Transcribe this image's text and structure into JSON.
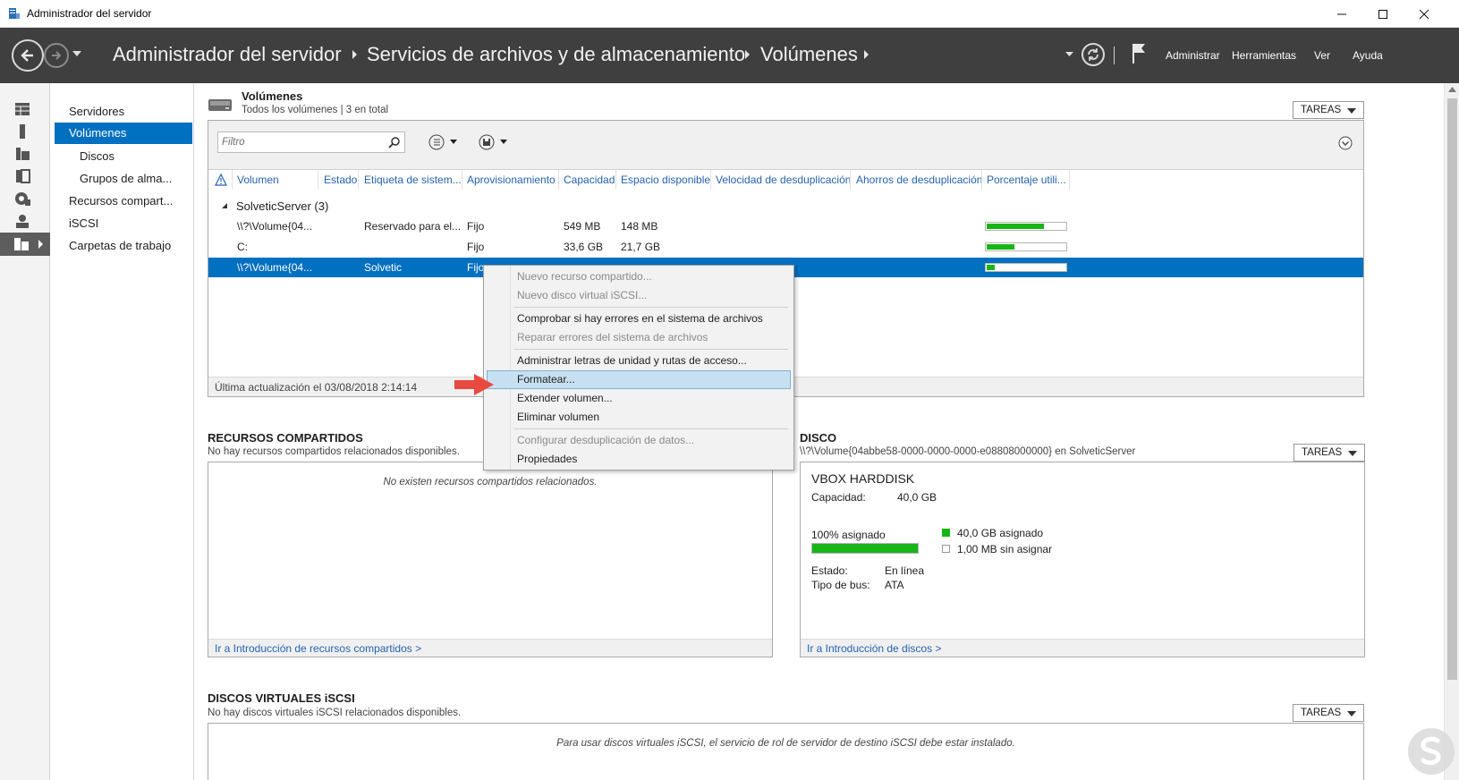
{
  "window": {
    "title": "Administrador del servidor"
  },
  "header": {
    "breadcrumb": [
      "Administrador del servidor",
      "Servicios de archivos y de almacenamiento",
      "Volúmenes"
    ],
    "menu": [
      "Administrar",
      "Herramientas",
      "Ver",
      "Ayuda"
    ]
  },
  "rail": {
    "icons": [
      "dashboard-icon",
      "local-server-icon",
      "all-servers-icon",
      "file-services-icon",
      "iis-icon",
      "roles-icon",
      "storage-icon"
    ]
  },
  "nav": {
    "items": [
      "Servidores",
      "Volúmenes",
      "Discos",
      "Grupos de alma...",
      "Recursos compart...",
      "iSCSI",
      "Carpetas de trabajo"
    ]
  },
  "volumes": {
    "title": "Volúmenes",
    "subtitle": "Todos los volúmenes | 3 en total",
    "tasks": "TAREAS",
    "filter_placeholder": "Filtro",
    "columns": [
      "Volumen",
      "Estado",
      "Etiqueta de sistem...",
      "Aprovisionamiento",
      "Capacidad",
      "Espacio disponible",
      "Velocidad de desduplicación",
      "Ahorros de desduplicación",
      "Porcentaje utili..."
    ],
    "group": "SolveticServer (3)",
    "rows": [
      {
        "volume": "\\\\?\\Volume{04...",
        "status": "",
        "label": "Reservado para el...",
        "provisioning": "Fijo",
        "capacity": "549 MB",
        "free": "148 MB",
        "used_fraction": 0.73
      },
      {
        "volume": "C:",
        "status": "",
        "label": "",
        "provisioning": "Fijo",
        "capacity": "33,6 GB",
        "free": "21,7 GB",
        "used_fraction": 0.35
      },
      {
        "volume": "\\\\?\\Volume{04...",
        "status": "",
        "label": "Solvetic",
        "provisioning": "Fijo",
        "capacity": "",
        "free": "",
        "used_fraction": 0.1
      }
    ],
    "last_update": "Última actualización el 03/08/2018 2:14:14"
  },
  "context_menu": {
    "items": [
      {
        "label": "Nuevo recurso compartido...",
        "disabled": true
      },
      {
        "label": "Nuevo disco virtual iSCSI...",
        "disabled": true
      },
      {
        "label": "Comprobar si hay errores en el sistema de archivos",
        "disabled": false
      },
      {
        "label": "Reparar errores del sistema de archivos",
        "disabled": true
      },
      {
        "label": "Administrar letras de unidad y rutas de acceso...",
        "disabled": false
      },
      {
        "label": "Formatear...",
        "disabled": false,
        "highlighted": true
      },
      {
        "label": "Extender volumen...",
        "disabled": false
      },
      {
        "label": "Eliminar volumen",
        "disabled": false
      },
      {
        "label": "Configurar desduplicación de datos...",
        "disabled": true
      },
      {
        "label": "Propiedades",
        "disabled": false
      }
    ]
  },
  "shares": {
    "title": "RECURSOS COMPARTIDOS",
    "subtitle": "No hay recursos compartidos relacionados disponibles.",
    "empty": "No existen recursos compartidos relacionados.",
    "link": "Ir a Introducción de recursos compartidos >"
  },
  "disk": {
    "title": "DISCO",
    "subtitle": "\\\\?\\Volume{04abbe58-0000-0000-0000-e08808000000} en SolveticServer",
    "tasks": "TAREAS",
    "name": "VBOX HARDDISK",
    "capacity_label": "Capacidad:",
    "capacity_value": "40,0 GB",
    "allocated_label": "100% asignado",
    "allocated_fraction": 1.0,
    "legend_allocated": "40,0 GB asignado",
    "legend_unallocated": "1,00 MB sin asignar",
    "status_label": "Estado:",
    "status_value": "En línea",
    "bus_label": "Tipo de bus:",
    "bus_value": "ATA",
    "link": "Ir a Introducción de discos >"
  },
  "iscsi": {
    "title": "DISCOS VIRTUALES iSCSI",
    "subtitle": "No hay discos virtuales iSCSI relacionados disponibles.",
    "tasks": "TAREAS",
    "empty": "Para usar discos virtuales iSCSI, el servicio de rol de servidor de destino iSCSI debe estar instalado."
  },
  "colors": {
    "accent": "#0070c0",
    "header": "#3f3f3f",
    "bar": "#17b516",
    "link": "#2563b0",
    "arrow": "#e84a3f"
  }
}
